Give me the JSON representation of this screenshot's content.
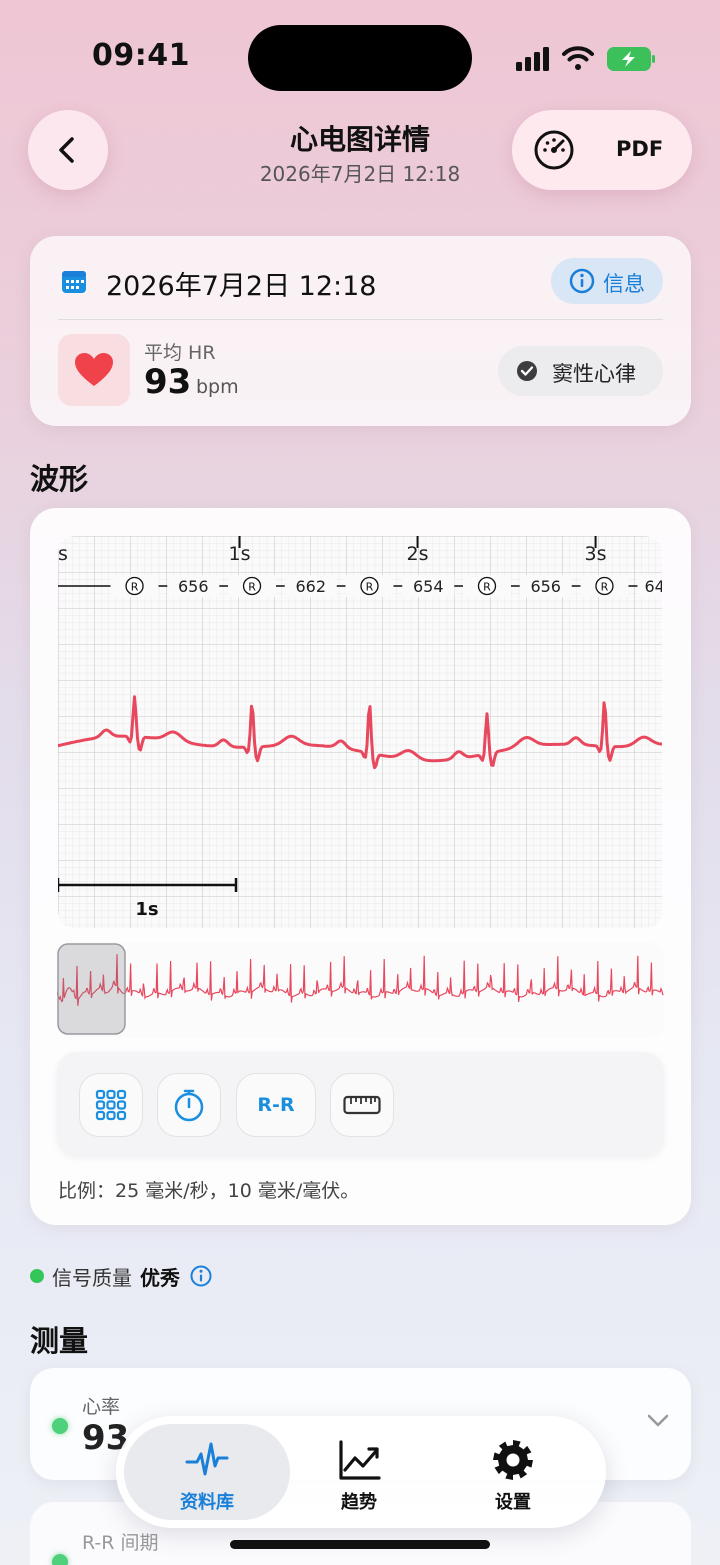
{
  "status_bar": {
    "time": "09:41"
  },
  "header": {
    "title": "心电图详情",
    "subtitle": "2026年7月2日 12:18",
    "pdf_label": "PDF"
  },
  "summary": {
    "date": "2026年7月2日 12:18",
    "info_label": "信息",
    "hr_label": "平均 HR",
    "hr_value": "93",
    "hr_unit": "bpm",
    "rhythm_label": "窦性心律"
  },
  "waveform": {
    "section_title": "波形",
    "time_labels": [
      "s",
      "1s",
      "2s",
      "3s"
    ],
    "rr_intervals": [
      "656",
      "662",
      "654",
      "656",
      "64"
    ],
    "r_marker": "R",
    "scale_bar_label": "1s",
    "tools": {
      "rr_label": "R-R"
    },
    "scale_note": "比例：25 毫米/秒，10 毫米/毫伏。"
  },
  "signal_quality": {
    "label": "信号质量",
    "value": "优秀"
  },
  "measurements": {
    "section_title": "测量",
    "items": [
      {
        "label": "心率",
        "value": "93"
      },
      {
        "label": "R-R 间期",
        "value": ""
      }
    ]
  },
  "tab_bar": {
    "tabs": [
      {
        "label": "资料库",
        "icon": "waveform-icon",
        "active": true
      },
      {
        "label": "趋势",
        "icon": "trend-chart-icon",
        "active": false
      },
      {
        "label": "设置",
        "icon": "gear-icon",
        "active": false
      }
    ]
  },
  "colors": {
    "accent": "#1a7fd8",
    "ecg_trace": "#e8485e",
    "heart": "#f0424a",
    "quality_good": "#33c659"
  }
}
